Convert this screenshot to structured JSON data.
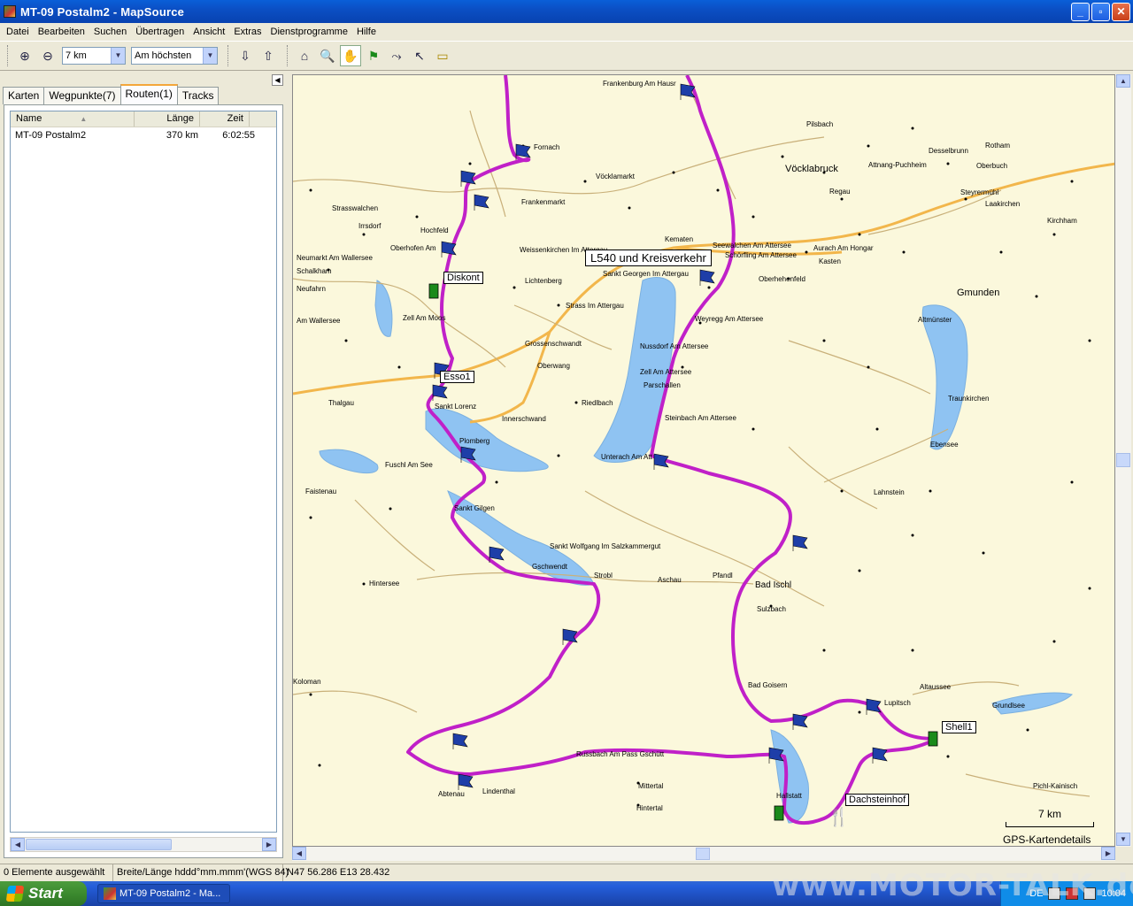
{
  "window": {
    "title": "MT-09 Postalm2 - MapSource"
  },
  "menu": [
    "Datei",
    "Bearbeiten",
    "Suchen",
    "Übertragen",
    "Ansicht",
    "Extras",
    "Dienstprogramme",
    "Hilfe"
  ],
  "toolbar": {
    "zoom_value": "7 km",
    "detail_value": "Am höchsten"
  },
  "tabs": [
    "Karten",
    "Wegpunkte(7)",
    "Routen(1)",
    "Tracks"
  ],
  "active_tab": "Routen(1)",
  "route_list": {
    "columns": [
      "Name",
      "Länge",
      "Zeit"
    ],
    "rows": [
      {
        "name": "MT-09 Postalm2",
        "length": "370 km",
        "time": "6:02:55"
      }
    ]
  },
  "map": {
    "labels": {
      "kreisverkehr": "L540 und Kreisverkehr",
      "diskont": "Diskont",
      "esso": "Esso1",
      "shell": "Shell1",
      "dachsteinhof": "Dachsteinhof"
    },
    "places": [
      "Frankenburg Am Hausr",
      "Fornach",
      "Vöcklamarkt",
      "Frankenmarkt",
      "Vöcklabruck",
      "Pilsbach",
      "Attnang-Puchheim",
      "Regau",
      "Desselbrunn",
      "Oberbuch",
      "Rotham",
      "Steyrermühl",
      "Laakirchen",
      "Kirchham",
      "Gmunden",
      "Altmünster",
      "Traunkirchen",
      "Ebensee",
      "Lahnstein",
      "Strasswalchen",
      "Irrsdorf",
      "Hochfeld",
      "Oberhofen Am",
      "Neumarkt Am Wallersee",
      "Schalkham",
      "Neufahrn",
      "Am Wallersee",
      "Zell Am Moos",
      "Thalgau",
      "Sankt Lorenz",
      "Plomberg",
      "Fuschl Am See",
      "Faistenau",
      "Sankt Gilgen",
      "Sankt Wolfgang Im Salzkammergut",
      "Gschwendt",
      "Strobl",
      "Hintersee",
      "Koloman",
      "Bad Ischl",
      "Pfandl",
      "Aschau",
      "Sulzbach",
      "Bad Goisern",
      "Altaussee",
      "Grundlsee",
      "Lupitsch",
      "Hallstatt",
      "Russbach Am Pass Gschütt",
      "Abtenau",
      "Lindenthal",
      "Mittertal",
      "Hintertal",
      "Pichl-Kainisch",
      "Sankt Georgen Im Attergau",
      "Weissenkirchen Im Attergau",
      "Lichtenberg",
      "Strass Im Attergau",
      "Grossenschwandt",
      "Oberwang",
      "Innerschwand",
      "Riedlbach",
      "Unterach Am Attersee",
      "Nussdorf Am Attersee",
      "Zell Am Attersee",
      "Parschallen",
      "Weyregg Am Attersee",
      "Steinbach Am Attersee",
      "Oberhehenfeld",
      "Seewalchen Am Attersee",
      "Schörfling Am Attersee",
      "Kematen",
      "Kasten",
      "Aurach Am Hongar",
      "Gmunden"
    ],
    "scale_label": "7 km",
    "detail_label": "GPS-Kartendetails"
  },
  "status": {
    "selection": "0 Elemente ausgewählt",
    "format": "Breite/Länge hddd°mm.mmm'(WGS 84)",
    "coords": "N47 56.286 E13 28.432"
  },
  "taskbar": {
    "start": "Start",
    "task": "MT-09 Postalm2 - Ma...",
    "lang": "DE",
    "clock": "10:04"
  },
  "watermark": "www.MOTOR-TALK.de"
}
